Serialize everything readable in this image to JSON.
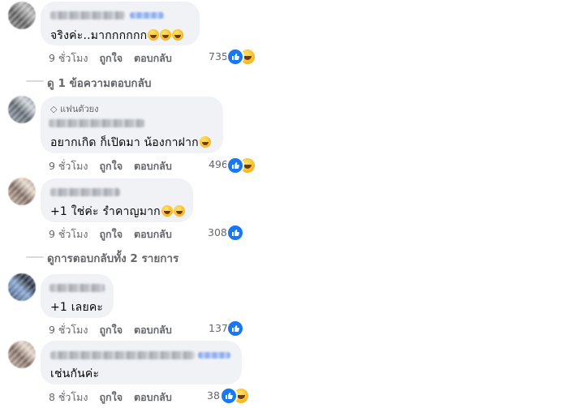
{
  "actions": {
    "like": "ถูกใจ",
    "reply": "ตอบกลับ"
  },
  "comments": [
    {
      "text": "จริงค่ะ..มากกกกกก",
      "time": "9 ชั่วโมง",
      "reaction_count": "735",
      "reactions": [
        "like-icon",
        "haha-icon"
      ],
      "emoji": [
        "rofl",
        "rofl",
        "rofl"
      ]
    },
    {
      "badge": "แฟนตัวยง",
      "text": "อยากเกิด ก็เปิดมา น้องกาฝาก",
      "time": "9 ชั่วโมง",
      "reaction_count": "496",
      "reactions": [
        "like-icon",
        "haha-icon"
      ],
      "emoji": [
        "laugh"
      ]
    },
    {
      "text": "+1 ใช่ค่ะ รำคาญมาก",
      "time": "9 ชั่วโมง",
      "reaction_count": "308",
      "reactions": [
        "like-icon"
      ],
      "emoji": [
        "smile",
        "smile"
      ]
    },
    {
      "text": "+1 เลยคะ",
      "time": "9 ชั่วโมง",
      "reaction_count": "137",
      "reactions": [
        "like-icon"
      ],
      "emoji": []
    },
    {
      "text": "เช่นกันค่ะ",
      "time": "8 ชั่วโมง",
      "reaction_count": "38",
      "reactions": [
        "like-icon",
        "haha-icon"
      ],
      "emoji": []
    }
  ],
  "view_replies": [
    {
      "label": "ดู 1 ข้อความตอบกลับ"
    },
    {
      "label": "ดูการตอบกลับทั้ง 2 รายการ"
    }
  ],
  "colors": {
    "bubble": "#f0f2f5",
    "meta": "#65676b",
    "like_blue": "#1877f2"
  }
}
